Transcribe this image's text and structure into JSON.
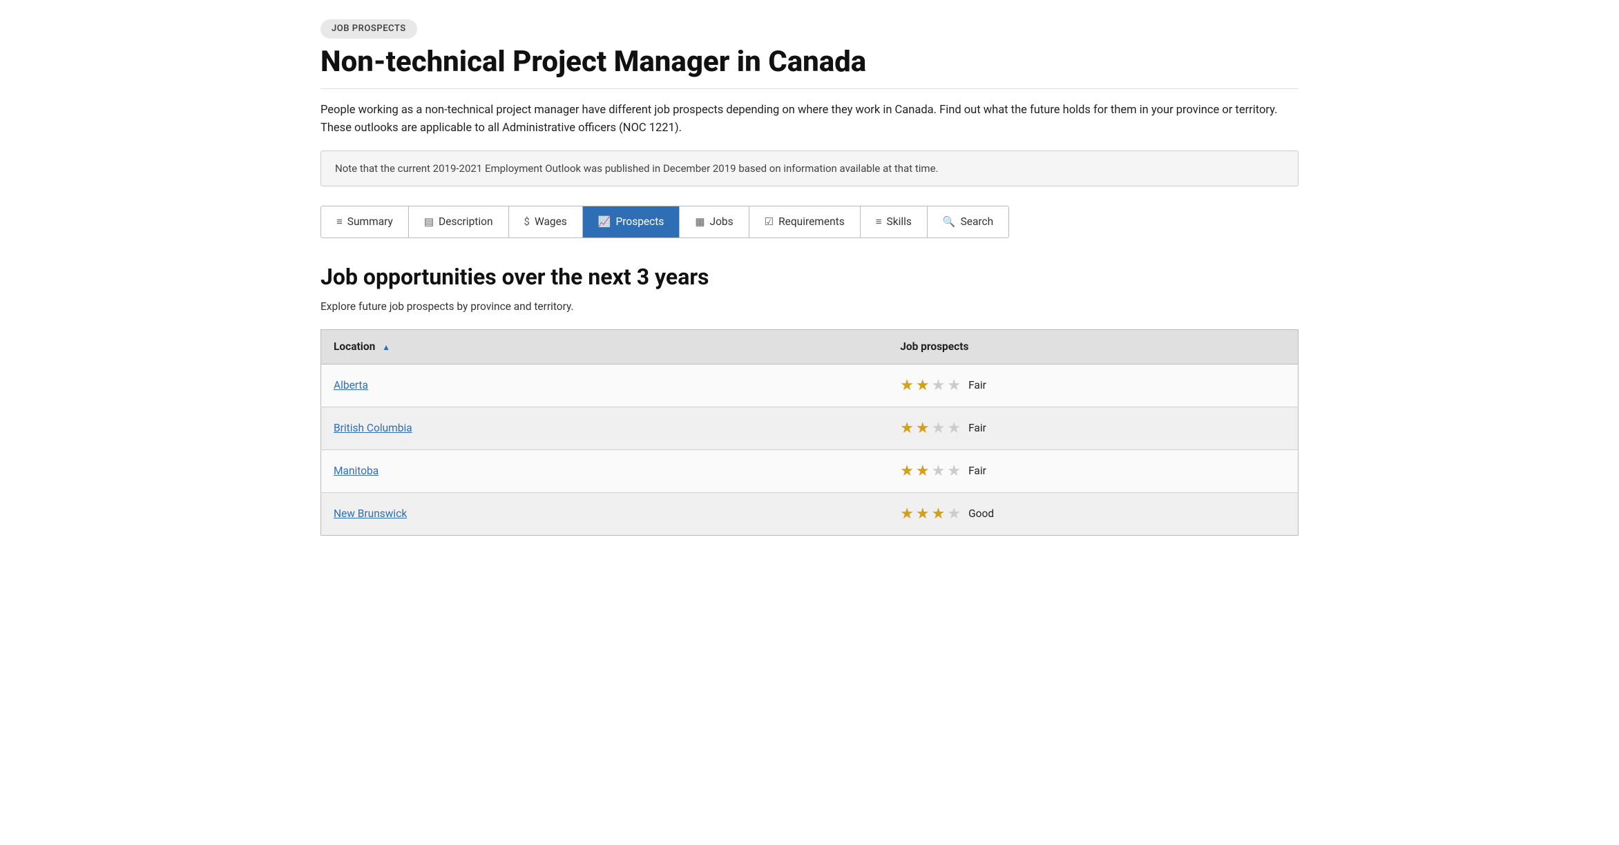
{
  "badge": "JOB PROSPECTS",
  "page_title": "Non-technical Project Manager in Canada",
  "intro_text": "People working as a non-technical project manager have different job prospects depending on where they work in Canada. Find out what the future holds for them in your province or territory. These outlooks are applicable to all Administrative officers (NOC 1221).",
  "note": "Note that the current 2019-2021 Employment Outlook was published in December 2019 based on information available at that time.",
  "tabs": [
    {
      "id": "summary",
      "label": "Summary",
      "icon": "≡",
      "active": false
    },
    {
      "id": "description",
      "label": "Description",
      "icon": "▤",
      "active": false
    },
    {
      "id": "wages",
      "label": "Wages",
      "icon": "$",
      "active": false
    },
    {
      "id": "prospects",
      "label": "Prospects",
      "icon": "📈",
      "active": true
    },
    {
      "id": "jobs",
      "label": "Jobs",
      "icon": "▦",
      "active": false
    },
    {
      "id": "requirements",
      "label": "Requirements",
      "icon": "☑",
      "active": false
    },
    {
      "id": "skills",
      "label": "Skills",
      "icon": "≡",
      "active": false
    },
    {
      "id": "search",
      "label": "Search",
      "icon": "🔍",
      "active": false
    }
  ],
  "section_title": "Job opportunities over the next 3 years",
  "section_subtitle": "Explore future job prospects by province and territory.",
  "table": {
    "col_location": "Location",
    "col_prospects": "Job prospects",
    "rows": [
      {
        "location": "Alberta",
        "rating": 2,
        "max_rating": 4,
        "label": "Fair"
      },
      {
        "location": "British Columbia",
        "rating": 2,
        "max_rating": 4,
        "label": "Fair"
      },
      {
        "location": "Manitoba",
        "rating": 2,
        "max_rating": 4,
        "label": "Fair"
      },
      {
        "location": "New Brunswick",
        "rating": 3,
        "max_rating": 4,
        "label": "Good"
      }
    ]
  },
  "colors": {
    "active_tab": "#2f6eb5",
    "star_filled": "#d4a017",
    "star_empty": "#ccc",
    "link": "#2f6eb5"
  }
}
